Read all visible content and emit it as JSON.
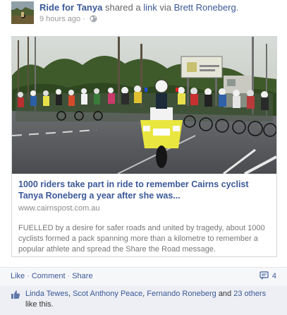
{
  "story": {
    "page_name": "Ride for Tanya",
    "shared_text": "shared a",
    "link_word": "link",
    "via_text": "via",
    "sharer_name": "Brett Roneberg",
    "period": ".",
    "timestamp": "9 hours ago",
    "dot": "·"
  },
  "attachment": {
    "title": "1000 riders take part in ride to remember Cairns cyclist Tanya Roneberg a year after she was...",
    "url": "www.cairnspost.com.au",
    "description": "FUELLED by a desire for safer roads and united by tragedy, about 1000 cyclists formed a pack spanning more than a kilometre to remember a popular athlete and spread the Share the Road message."
  },
  "actions": {
    "like": "Like",
    "comment": "Comment",
    "share": "Share",
    "sep": "·",
    "comment_count": "4"
  },
  "likes": {
    "names": [
      "Linda Tewes",
      "Scot Anthony Peace",
      "Fernando Roneberg"
    ],
    "comma": ",",
    "and": "and",
    "others": "23 others",
    "tail": "like this."
  },
  "colors": {
    "link": "#3b5998",
    "meta": "#999999",
    "action_bar": "#f6f7f9",
    "likes_bg": "#edeff4"
  }
}
